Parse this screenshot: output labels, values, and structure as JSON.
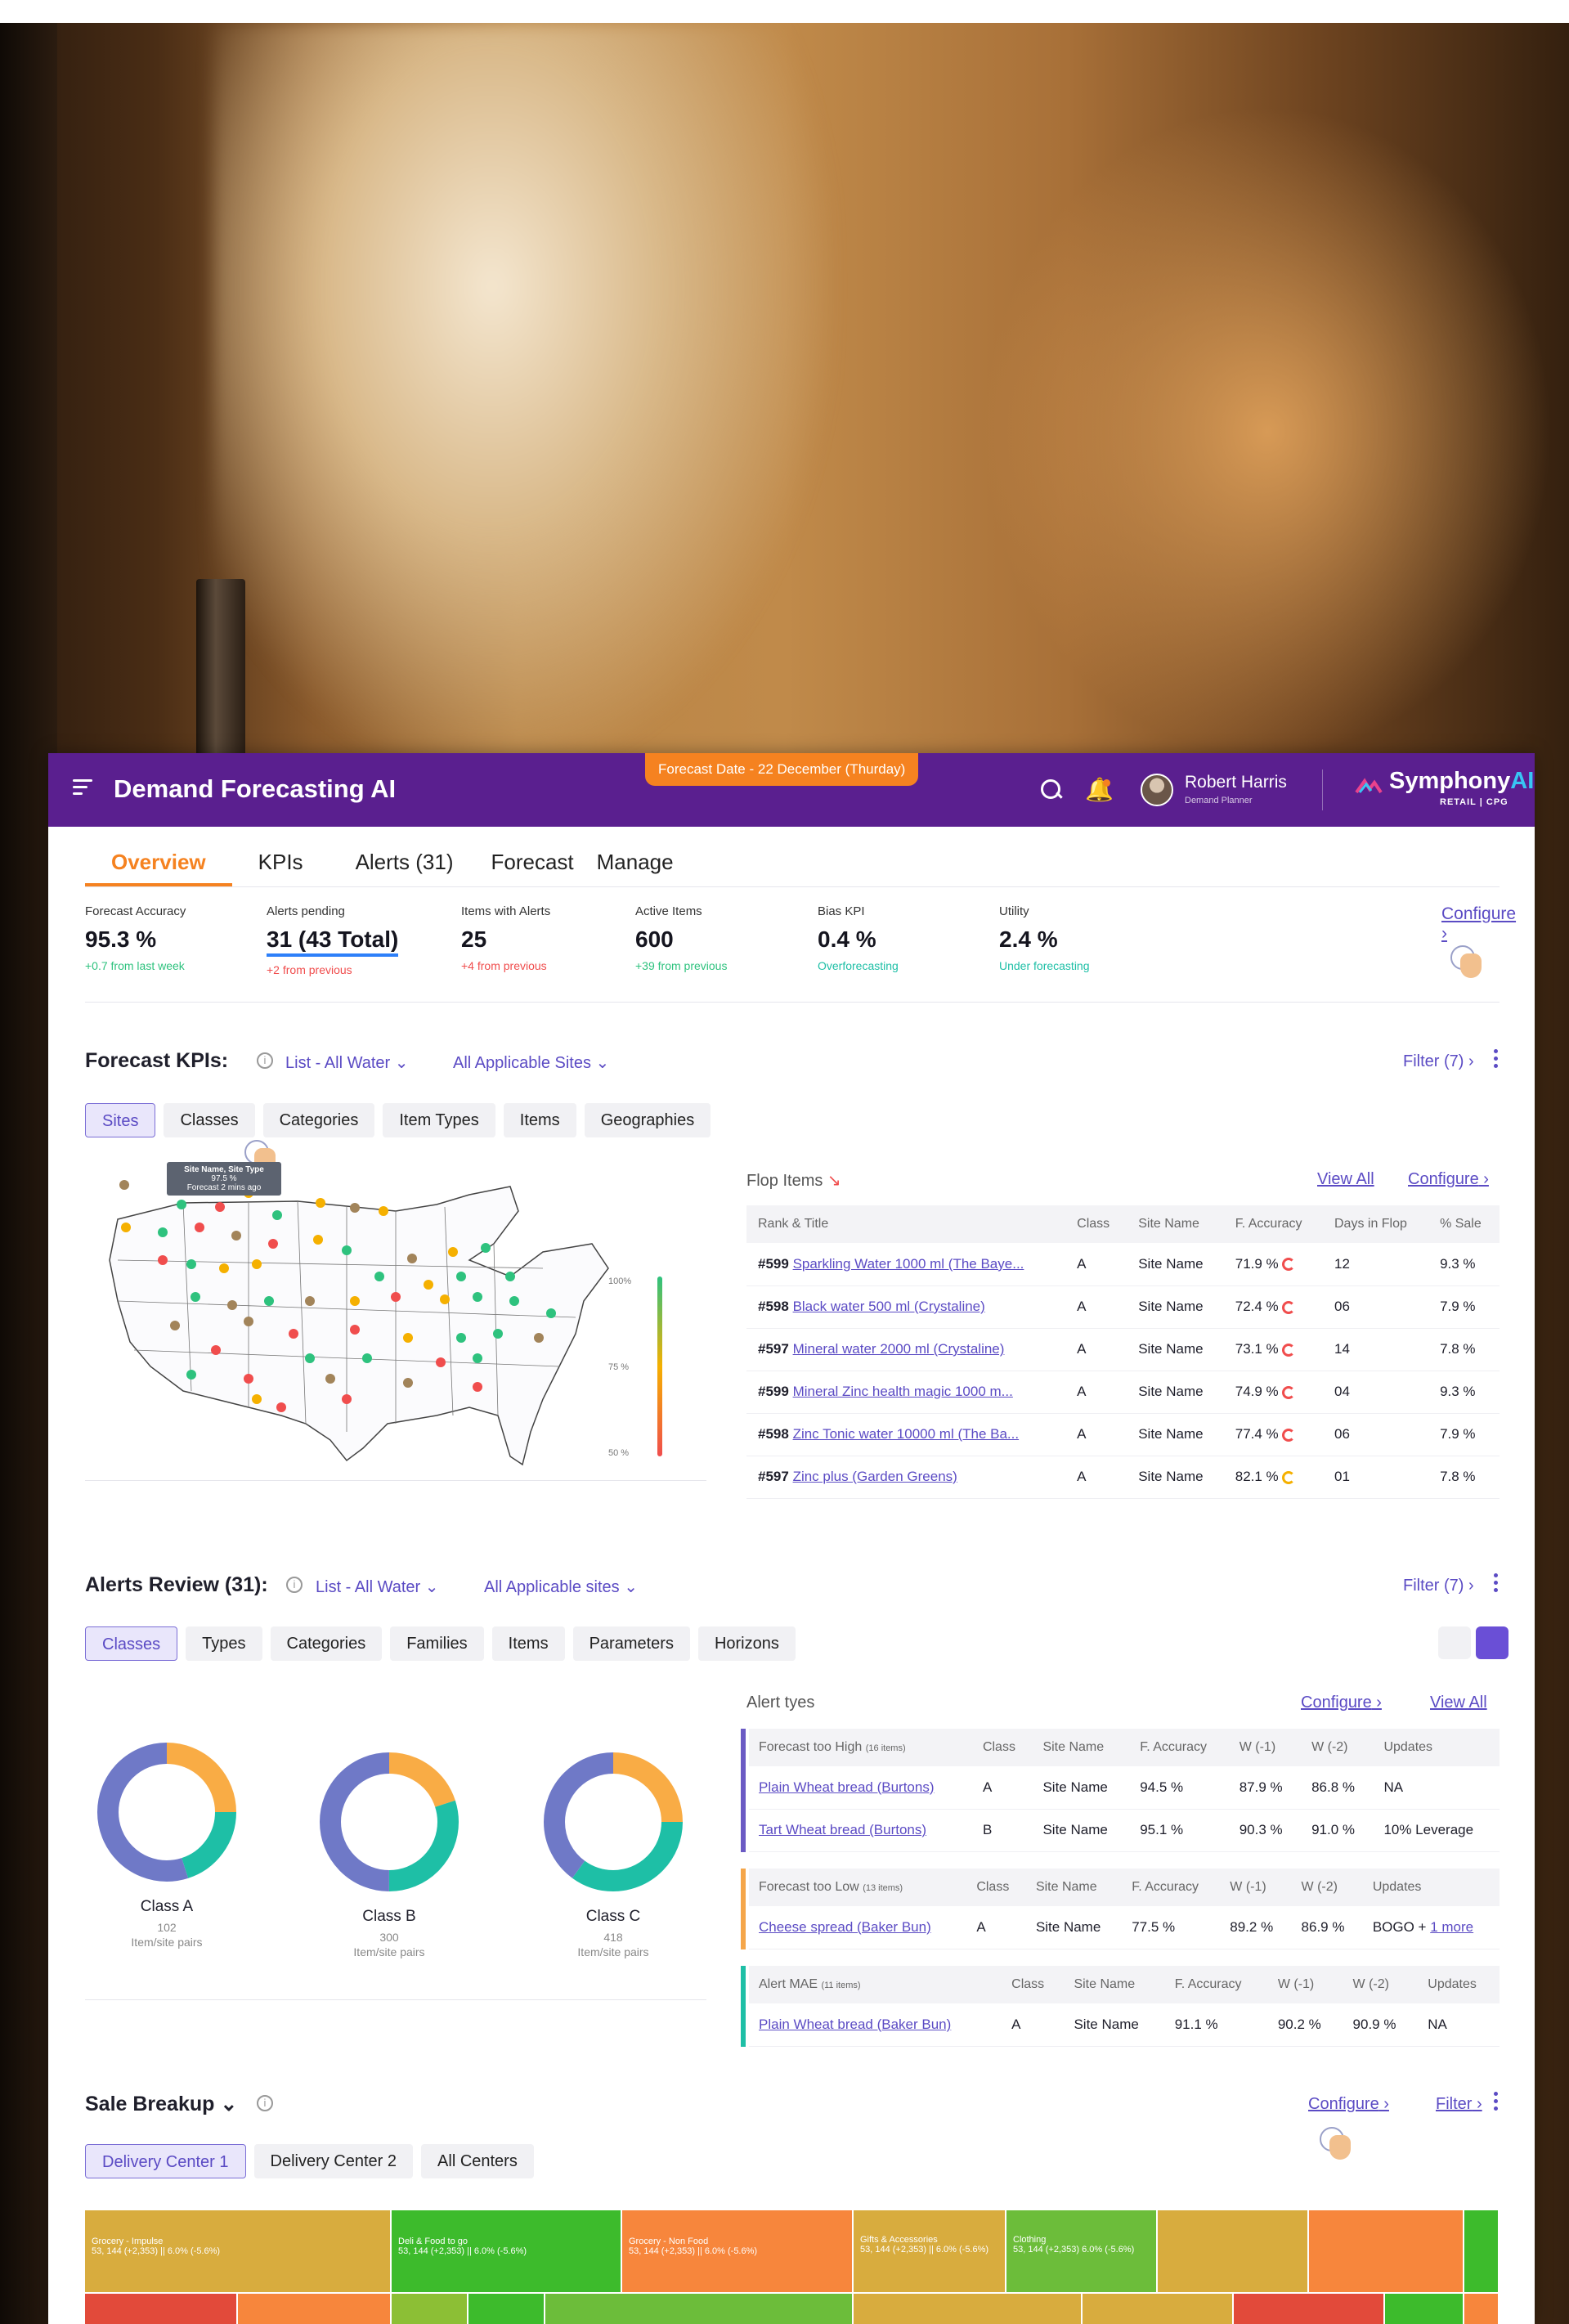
{
  "header": {
    "app_title": "Demand Forecasting AI",
    "forecast_date": "Forecast Date - 22 December (Thurday)",
    "user_name": "Robert Harris",
    "user_role": "Demand Planner",
    "logo_name": "Symphony",
    "logo_ai": "AI",
    "logo_sub": "RETAIL | CPG"
  },
  "tabs": [
    {
      "label": "Overview"
    },
    {
      "label": "KPIs"
    },
    {
      "label": "Alerts (31)"
    },
    {
      "label": "Forecast"
    },
    {
      "label": "Manage"
    }
  ],
  "kpis": {
    "items": [
      {
        "label": "Forecast Accuracy",
        "value": "95.3 %",
        "delta": "+0.7 from last week"
      },
      {
        "label": "Alerts pending",
        "value": "31 (43 Total)",
        "delta": "+2 from previous"
      },
      {
        "label": "Items with Alerts",
        "value": "25",
        "delta": "+4 from previous"
      },
      {
        "label": "Active Items",
        "value": "600",
        "delta": "+39 from previous"
      },
      {
        "label": "Bias KPI",
        "value": "0.4 %",
        "delta": "Overforecasting"
      },
      {
        "label": "Utility",
        "value": "2.4 %",
        "delta": "Under forecasting"
      }
    ],
    "configure": "Configure"
  },
  "forecast_kpis": {
    "title": "Forecast KPIs:",
    "list": "List - All Water",
    "sites": "All Applicable Sites",
    "filter": "Filter (7)",
    "chips": [
      {
        "label": "Sites"
      },
      {
        "label": "Classes"
      },
      {
        "label": "Categories"
      },
      {
        "label": "Item Types"
      },
      {
        "label": "Items"
      },
      {
        "label": "Geographies"
      }
    ],
    "map_tooltip": {
      "line1": "Site Name, Site Type",
      "line2": "97.5 %",
      "line3": "Forecast 2 mins ago"
    },
    "legend": {
      "top": "100%",
      "mid": "75 %",
      "bottom": "50 %"
    }
  },
  "flop_items": {
    "title": "Flop Items",
    "view_all": "View All",
    "configure": "Configure",
    "columns": [
      "Rank & Title",
      "Class",
      "Site Name",
      "F. Accuracy",
      "Days in Flop",
      "% Sale"
    ],
    "rows": [
      {
        "rank": "#599",
        "item": "Sparkling Water 1000 ml (The Baye...",
        "class": "A",
        "site": "Site Name",
        "acc": "71.9 %",
        "days": "12",
        "sale": "9.3 %"
      },
      {
        "rank": "#598",
        "item": "Black water 500 ml (Crystaline)",
        "class": "A",
        "site": "Site Name",
        "acc": "72.4 %",
        "days": "06",
        "sale": "7.9 %"
      },
      {
        "rank": "#597",
        "item": "Mineral water 2000 ml (Crystaline)",
        "class": "A",
        "site": "Site Name",
        "acc": "73.1 %",
        "days": "14",
        "sale": "7.8 %"
      },
      {
        "rank": "#599",
        "item": "Mineral Zinc health magic 1000 m...",
        "class": "A",
        "site": "Site Name",
        "acc": "74.9 %",
        "days": "04",
        "sale": "9.3 %"
      },
      {
        "rank": "#598",
        "item": "Zinc Tonic water 10000 ml (The Ba...",
        "class": "A",
        "site": "Site Name",
        "acc": "77.4 %",
        "days": "06",
        "sale": "7.9 %"
      },
      {
        "rank": "#597",
        "item": "Zinc plus (Garden Greens)",
        "class": "A",
        "site": "Site Name",
        "acc": "82.1 %",
        "days": "01",
        "sale": "7.8 %"
      }
    ]
  },
  "alerts_review": {
    "title": "Alerts Review (31):",
    "list": "List - All Water",
    "sites": "All Applicable sites",
    "filter": "Filter (7)",
    "chips": [
      {
        "label": "Classes"
      },
      {
        "label": "Types"
      },
      {
        "label": "Categories"
      },
      {
        "label": "Families"
      },
      {
        "label": "Items"
      },
      {
        "label": "Parameters"
      },
      {
        "label": "Horizons"
      }
    ],
    "donuts": [
      {
        "label": "Class A",
        "count": "102",
        "sub": "Item/site pairs",
        "slices": [
          0.25,
          0.2,
          0.55
        ]
      },
      {
        "label": "Class B",
        "count": "300",
        "sub": "Item/site pairs",
        "slices": [
          0.2,
          0.3,
          0.5
        ]
      },
      {
        "label": "Class C",
        "count": "418",
        "sub": "Item/site pairs",
        "slices": [
          0.25,
          0.35,
          0.4
        ]
      }
    ],
    "alert_types_title": "Alert tyes",
    "configure": "Configure",
    "view_all": "View All",
    "groups": [
      {
        "name": "Forecast too High",
        "count": "(16 items)",
        "color": "#6b5bc4",
        "columns": [
          "Class",
          "Site Name",
          "F. Accuracy",
          "W (-1)",
          "W (-2)",
          "Updates"
        ],
        "rows": [
          {
            "item": "Plain Wheat bread (Burtons)",
            "class": "A",
            "site": "Site Name",
            "acc": "94.5 %",
            "w1": "87.9 %",
            "w2": "86.8 %",
            "upd": "NA",
            "more": ""
          },
          {
            "item": "Tart Wheat bread (Burtons)",
            "class": "B",
            "site": "Site Name",
            "acc": "95.1 %",
            "w1": "90.3 %",
            "w2": "91.0 %",
            "upd": "10% Leverage",
            "more": ""
          }
        ]
      },
      {
        "name": "Forecast too Low",
        "count": "(13 items)",
        "color": "#f5a64a",
        "columns": [
          "Class",
          "Site Name",
          "F. Accuracy",
          "W (-1)",
          "W (-2)",
          "Updates"
        ],
        "rows": [
          {
            "item": "Cheese spread (Baker Bun)",
            "class": "A",
            "site": "Site Name",
            "acc": "77.5 %",
            "w1": "89.2 %",
            "w2": "86.9 %",
            "upd": "BOGO + ",
            "more": "1 more"
          }
        ]
      },
      {
        "name": "Alert MAE",
        "count": "(11 items)",
        "color": "#1ebfa6",
        "columns": [
          "Class",
          "Site Name",
          "F. Accuracy",
          "W (-1)",
          "W (-2)",
          "Updates"
        ],
        "rows": [
          {
            "item": "Plain Wheat bread (Baker Bun)",
            "class": "A",
            "site": "Site Name",
            "acc": "91.1 %",
            "w1": "90.2 %",
            "w2": "90.9 %",
            "upd": "NA",
            "more": ""
          }
        ]
      }
    ]
  },
  "sale_breakup": {
    "title": "Sale Breakup",
    "configure": "Configure",
    "filter": "Filter",
    "chips": [
      {
        "label": "Delivery Center 1"
      },
      {
        "label": "Delivery Center  2"
      },
      {
        "label": "All Centers"
      }
    ],
    "tiles": [
      {
        "name": "Grocery - Impulse",
        "detail": "53, 144 (+2,353) || 6.0% (-5.6%)"
      },
      {
        "name": "Deli & Food to go",
        "detail": "53, 144 (+2,353) || 6.0% (-5.6%)"
      },
      {
        "name": "Grocery - Non Food",
        "detail": "53, 144 (+2,353) || 6.0% (-5.6%)"
      },
      {
        "name": "Gifts & Accessories",
        "detail": "53, 144 (+2,353) || 6.0% (-5.6%)"
      },
      {
        "name": "Clothing",
        "detail": "53, 144 (+2,353) 6.0% (-5.6%)"
      }
    ]
  }
}
